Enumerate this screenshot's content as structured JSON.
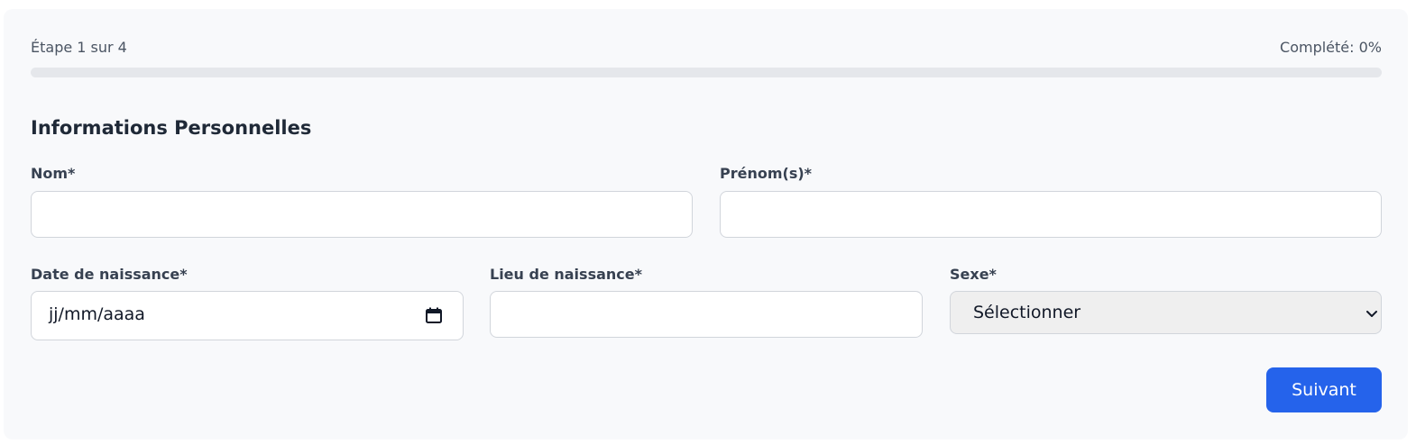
{
  "progress": {
    "step_label": "Étape 1 sur 4",
    "completed_label": "Complété: 0%",
    "completed_fraction": 0.0
  },
  "form": {
    "section_title": "Informations Personnelles",
    "fields": {
      "nom": {
        "label": "Nom*",
        "value": ""
      },
      "prenom": {
        "label": "Prénom(s)*",
        "value": ""
      },
      "date_naissance": {
        "label": "Date de naissance*",
        "placeholder": "jj/mm/aaaa",
        "icon": "calendar-icon"
      },
      "lieu_naissance": {
        "label": "Lieu de naissance*",
        "value": ""
      },
      "sexe": {
        "label": "Sexe*",
        "selected": "Sélectionner",
        "icon": "chevron-down-icon"
      }
    },
    "next_label": "Suivant"
  },
  "colors": {
    "accent": "#2563eb",
    "card_background": "#f8f9fb",
    "progress_track": "#e5e7eb"
  }
}
